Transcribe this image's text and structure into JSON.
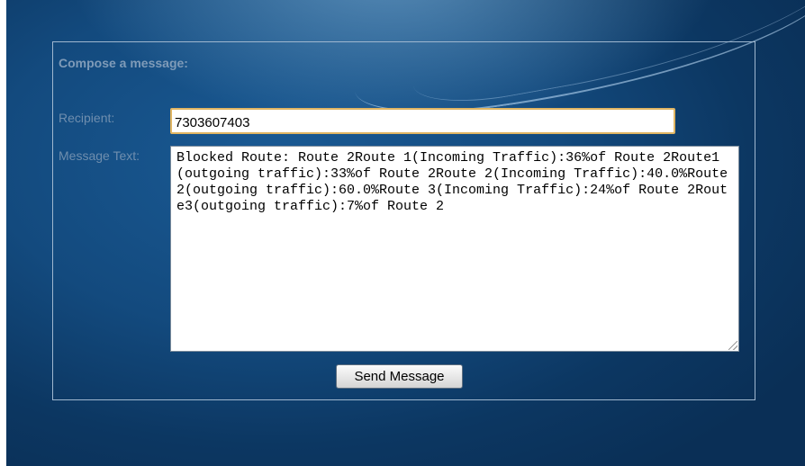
{
  "compose": {
    "title": "Compose a message:",
    "recipient_label": "Recipient:",
    "recipient_value": "7303607403",
    "message_label": "Message Text:",
    "message_value": "Blocked Route: Route 2Route 1(Incoming Traffic):36%of Route 2Route1(outgoing traffic):33%of Route 2Route 2(Incoming Traffic):40.0%Route2(outgoing traffic):60.0%Route 3(Incoming Traffic):24%of Route 2Route3(outgoing traffic):7%of Route 2",
    "send_label": "Send Message"
  }
}
